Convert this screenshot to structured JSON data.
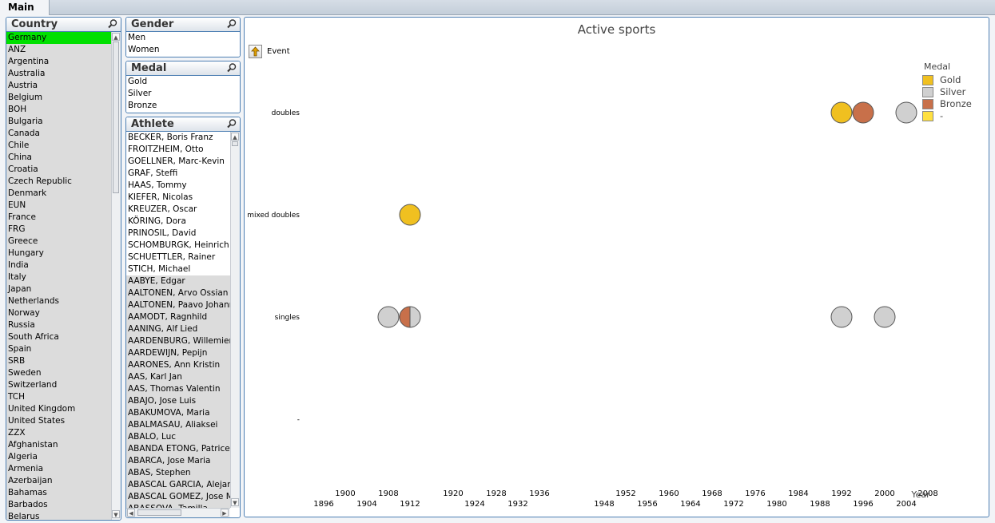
{
  "tab": {
    "label": "Main"
  },
  "country": {
    "caption": "Country",
    "items": [
      "Germany",
      "ANZ",
      "Argentina",
      "Australia",
      "Austria",
      "Belgium",
      "BOH",
      "Bulgaria",
      "Canada",
      "Chile",
      "China",
      "Croatia",
      "Czech Republic",
      "Denmark",
      "EUN",
      "France",
      "FRG",
      "Greece",
      "Hungary",
      "India",
      "Italy",
      "Japan",
      "Netherlands",
      "Norway",
      "Russia",
      "South Africa",
      "Spain",
      "SRB",
      "Sweden",
      "Switzerland",
      "TCH",
      "United Kingdom",
      "United States",
      "ZZX",
      "Afghanistan",
      "Algeria",
      "Armenia",
      "Azerbaijan",
      "Bahamas",
      "Barbados",
      "Belarus"
    ]
  },
  "gender": {
    "caption": "Gender",
    "items": [
      "Men",
      "Women"
    ]
  },
  "medal": {
    "caption": "Medal",
    "items": [
      "Gold",
      "Silver",
      "Bronze"
    ]
  },
  "athlete": {
    "caption": "Athlete",
    "possible": [
      "BECKER, Boris Franz",
      "FROITZHEIM, Otto",
      "GOELLNER, Marc-Kevin",
      "GRAF, Steffi",
      "HAAS, Tommy",
      "KIEFER, Nicolas",
      "KREUZER, Oscar",
      "KÖRING, Dora",
      "PRINOSIL, David",
      "SCHOMBURGK, Heinrich",
      "SCHUETTLER, Rainer",
      "STICH, Michael"
    ],
    "excluded": [
      "AABYE, Edgar",
      "AALTONEN, Arvo Ossian",
      "AALTONEN, Paavo Johannes",
      "AAMODT, Ragnhild",
      "AANING, Alf Lied",
      "AARDENBURG, Willemien",
      "AARDEWIJN, Pepijn",
      "AARONES, Ann Kristin",
      "AAS, Karl Jan",
      "AAS, Thomas Valentin",
      "ABAJO, Jose Luis",
      "ABAKUMOVA, Maria",
      "ABALMASAU, Aliaksei",
      "ABALO, Luc",
      "ABANDA ETONG, Patrice",
      "ABARCA, Jose Maria",
      "ABAS, Stephen",
      "ABASCAL GARCIA, Alejandro",
      "ABASCAL GOMEZ, Jose Manuel",
      "ABASSOVA, Tamilla"
    ]
  },
  "chart": {
    "dimension_label": "Event",
    "x_title": "Year",
    "legend_title": "Medal",
    "legend": [
      {
        "label": "Gold",
        "color": "#f0c020"
      },
      {
        "label": "Silver",
        "color": "#d0d0d0"
      },
      {
        "label": "Bronze",
        "color": "#c8704a"
      },
      {
        "label": "-",
        "color": "#ffe040"
      }
    ]
  },
  "chart_data": {
    "type": "scatter",
    "title": "Active sports",
    "xlabel": "Year",
    "ylabel": "",
    "y_categories": [
      "doubles",
      "mixed doubles",
      "singles",
      "-"
    ],
    "x_ticks_top": [
      1900,
      1908,
      1920,
      1928,
      1936,
      1952,
      1960,
      1968,
      1976,
      1984,
      1992,
      2000,
      2008
    ],
    "x_ticks_bottom": [
      1896,
      1904,
      1912,
      1924,
      1932,
      1948,
      1956,
      1964,
      1972,
      1980,
      1988,
      1996,
      2004
    ],
    "points": [
      {
        "event": "doubles",
        "year": 1992,
        "medals": [
          "Gold"
        ]
      },
      {
        "event": "doubles",
        "year": 1996,
        "medals": [
          "Bronze"
        ]
      },
      {
        "event": "doubles",
        "year": 2004,
        "medals": [
          "Silver"
        ]
      },
      {
        "event": "mixed doubles",
        "year": 1912,
        "medals": [
          "Gold"
        ]
      },
      {
        "event": "singles",
        "year": 1908,
        "medals": [
          "Silver"
        ]
      },
      {
        "event": "singles",
        "year": 1912,
        "medals": [
          "Bronze",
          "Silver"
        ]
      },
      {
        "event": "singles",
        "year": 1992,
        "medals": [
          "Silver"
        ]
      },
      {
        "event": "singles",
        "year": 2000,
        "medals": [
          "Silver"
        ]
      }
    ]
  }
}
